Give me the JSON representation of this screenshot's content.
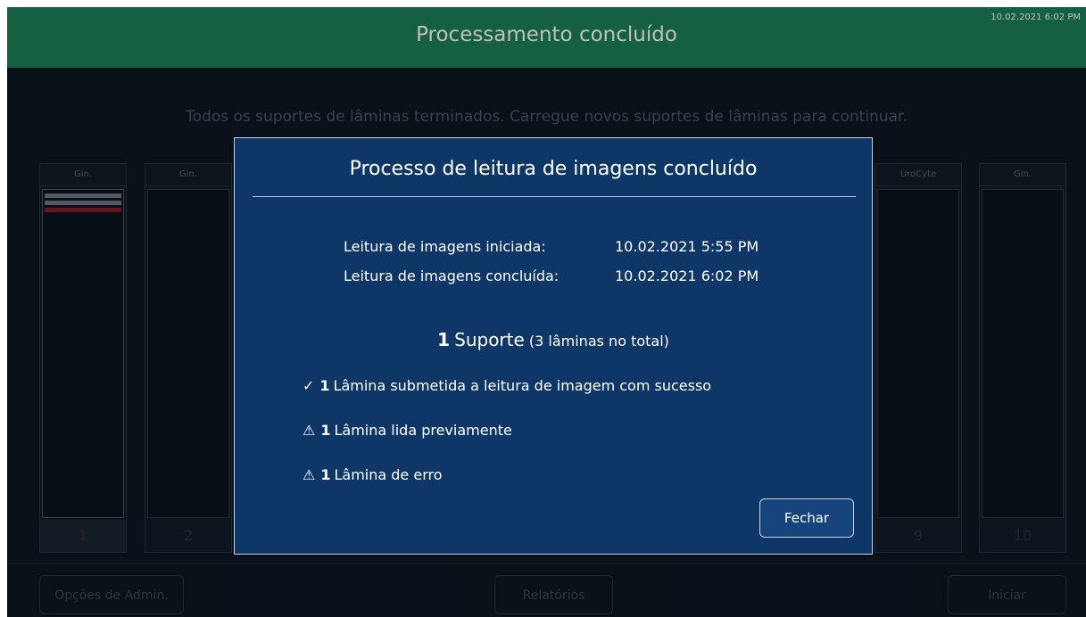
{
  "header": {
    "title": "Processamento concluído",
    "timestamp": "10.02.2021 6:02 PM"
  },
  "banner": "Todos os suportes de lâminas terminados. Carregue novos suportes de lâminas para continuar.",
  "holders": [
    {
      "type": "Gin.",
      "number": "1"
    },
    {
      "type": "Gin.",
      "number": "2"
    },
    {
      "type": "UroCyte",
      "number": "9"
    },
    {
      "type": "Gin.",
      "number": "10"
    }
  ],
  "footer": {
    "admin_label": "Opções de Admin.",
    "reports_label": "Relatórios",
    "start_label": "Iniciar"
  },
  "dialog": {
    "title": "Processo de leitura de imagens concluído",
    "started_label": "Leitura de imagens iniciada:",
    "started_value": "10.02.2021 5:55 PM",
    "finished_label": "Leitura de imagens concluída:",
    "finished_value": "10.02.2021 6:02 PM",
    "summary": {
      "count": "1",
      "word": "Suporte",
      "detail": "(3 lâminas no total)"
    },
    "results": [
      {
        "icon": "check-icon",
        "glyph": "✓",
        "count": "1",
        "text": "Lâmina submetida a leitura de imagem com sucesso"
      },
      {
        "icon": "warning-icon",
        "glyph": "⚠",
        "count": "1",
        "text": "Lâmina lida previamente"
      },
      {
        "icon": "warning-icon",
        "glyph": "⚠",
        "count": "1",
        "text": "Lâmina de erro"
      }
    ],
    "close_label": "Fechar"
  },
  "colors": {
    "header_green": "#1d8157",
    "dialog_blue": "#0e3768",
    "slide_error": "#8b1a2b",
    "slide_gray": "#6c7680"
  }
}
